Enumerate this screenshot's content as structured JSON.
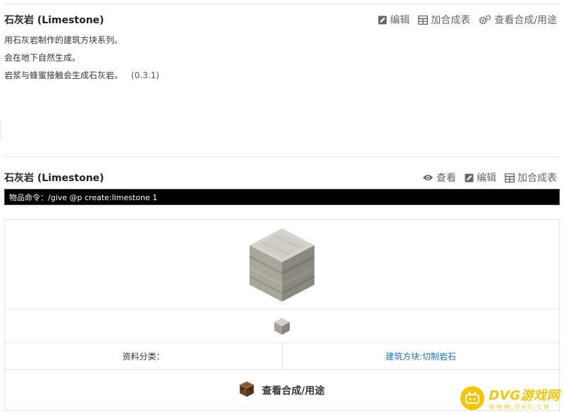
{
  "section1": {
    "title": "石灰岩 (Limestone)",
    "actions": [
      {
        "label": "编辑",
        "icon": "edit-icon"
      },
      {
        "label": "加合成表",
        "icon": "table-icon"
      },
      {
        "label": "查看合成/用途",
        "icon": "gears-icon"
      }
    ],
    "desc": [
      "用石灰岩制作的建筑方块系列。",
      "会在地下自然生成。",
      "岩浆与蜂蜜接触会生成石灰岩。"
    ],
    "version": "(0.3.1)"
  },
  "section2": {
    "title": "石灰岩 (Limestone)",
    "actions": [
      {
        "label": "查看",
        "icon": "eye-icon"
      },
      {
        "label": "编辑",
        "icon": "edit-icon"
      },
      {
        "label": "加合成表",
        "icon": "table-icon"
      }
    ],
    "command": "物品命令：/give @p create:limestone 1",
    "category_label": "资料分类：",
    "category_value": "建筑方块:切制岩石",
    "view_recipes": "查看合成/用途"
  },
  "watermark": {
    "main": "DVG游戏网",
    "sub": "WWW.DVG.CN"
  },
  "colors": {
    "accent_link": "#1a6fc4",
    "watermark": "#f5c400",
    "command_bg": "#000000"
  }
}
